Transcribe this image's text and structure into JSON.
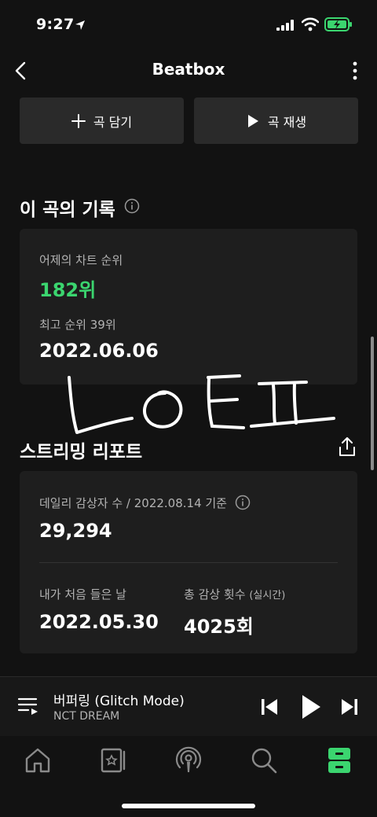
{
  "status": {
    "time": "9:27"
  },
  "nav": {
    "title": "Beatbox"
  },
  "actions": {
    "add_label": "곡 담기",
    "play_label": "곡 재생"
  },
  "history": {
    "title": "이 곡의 기록",
    "yesterday_rank_label": "어제의 차트 순위",
    "yesterday_rank_value": "182위",
    "best_rank_label": "최고 순위 39위",
    "best_rank_date": "2022.06.06"
  },
  "handwriting": {
    "text": "ㄴㅇㅌㅍ"
  },
  "streaming": {
    "title": "스트리밍 리포트",
    "daily_listeners_label": "데일리 감상자 수 / 2022.08.14 기준",
    "daily_listeners_value": "29,294",
    "first_listen_label": "내가 처음 들은 날",
    "first_listen_value": "2022.05.30",
    "total_plays_label": "총 감상 횟수",
    "total_plays_note": "(실시간)",
    "total_plays_value": "4025회"
  },
  "player": {
    "title": "버퍼링 (Glitch Mode)",
    "artist": "NCT DREAM"
  },
  "tabs": [
    "home-icon",
    "library-icon",
    "podcast-icon",
    "search-icon",
    "locker-icon"
  ],
  "colors": {
    "accent": "#3bd56f",
    "background": "#121212",
    "card": "#1e1e1e"
  }
}
